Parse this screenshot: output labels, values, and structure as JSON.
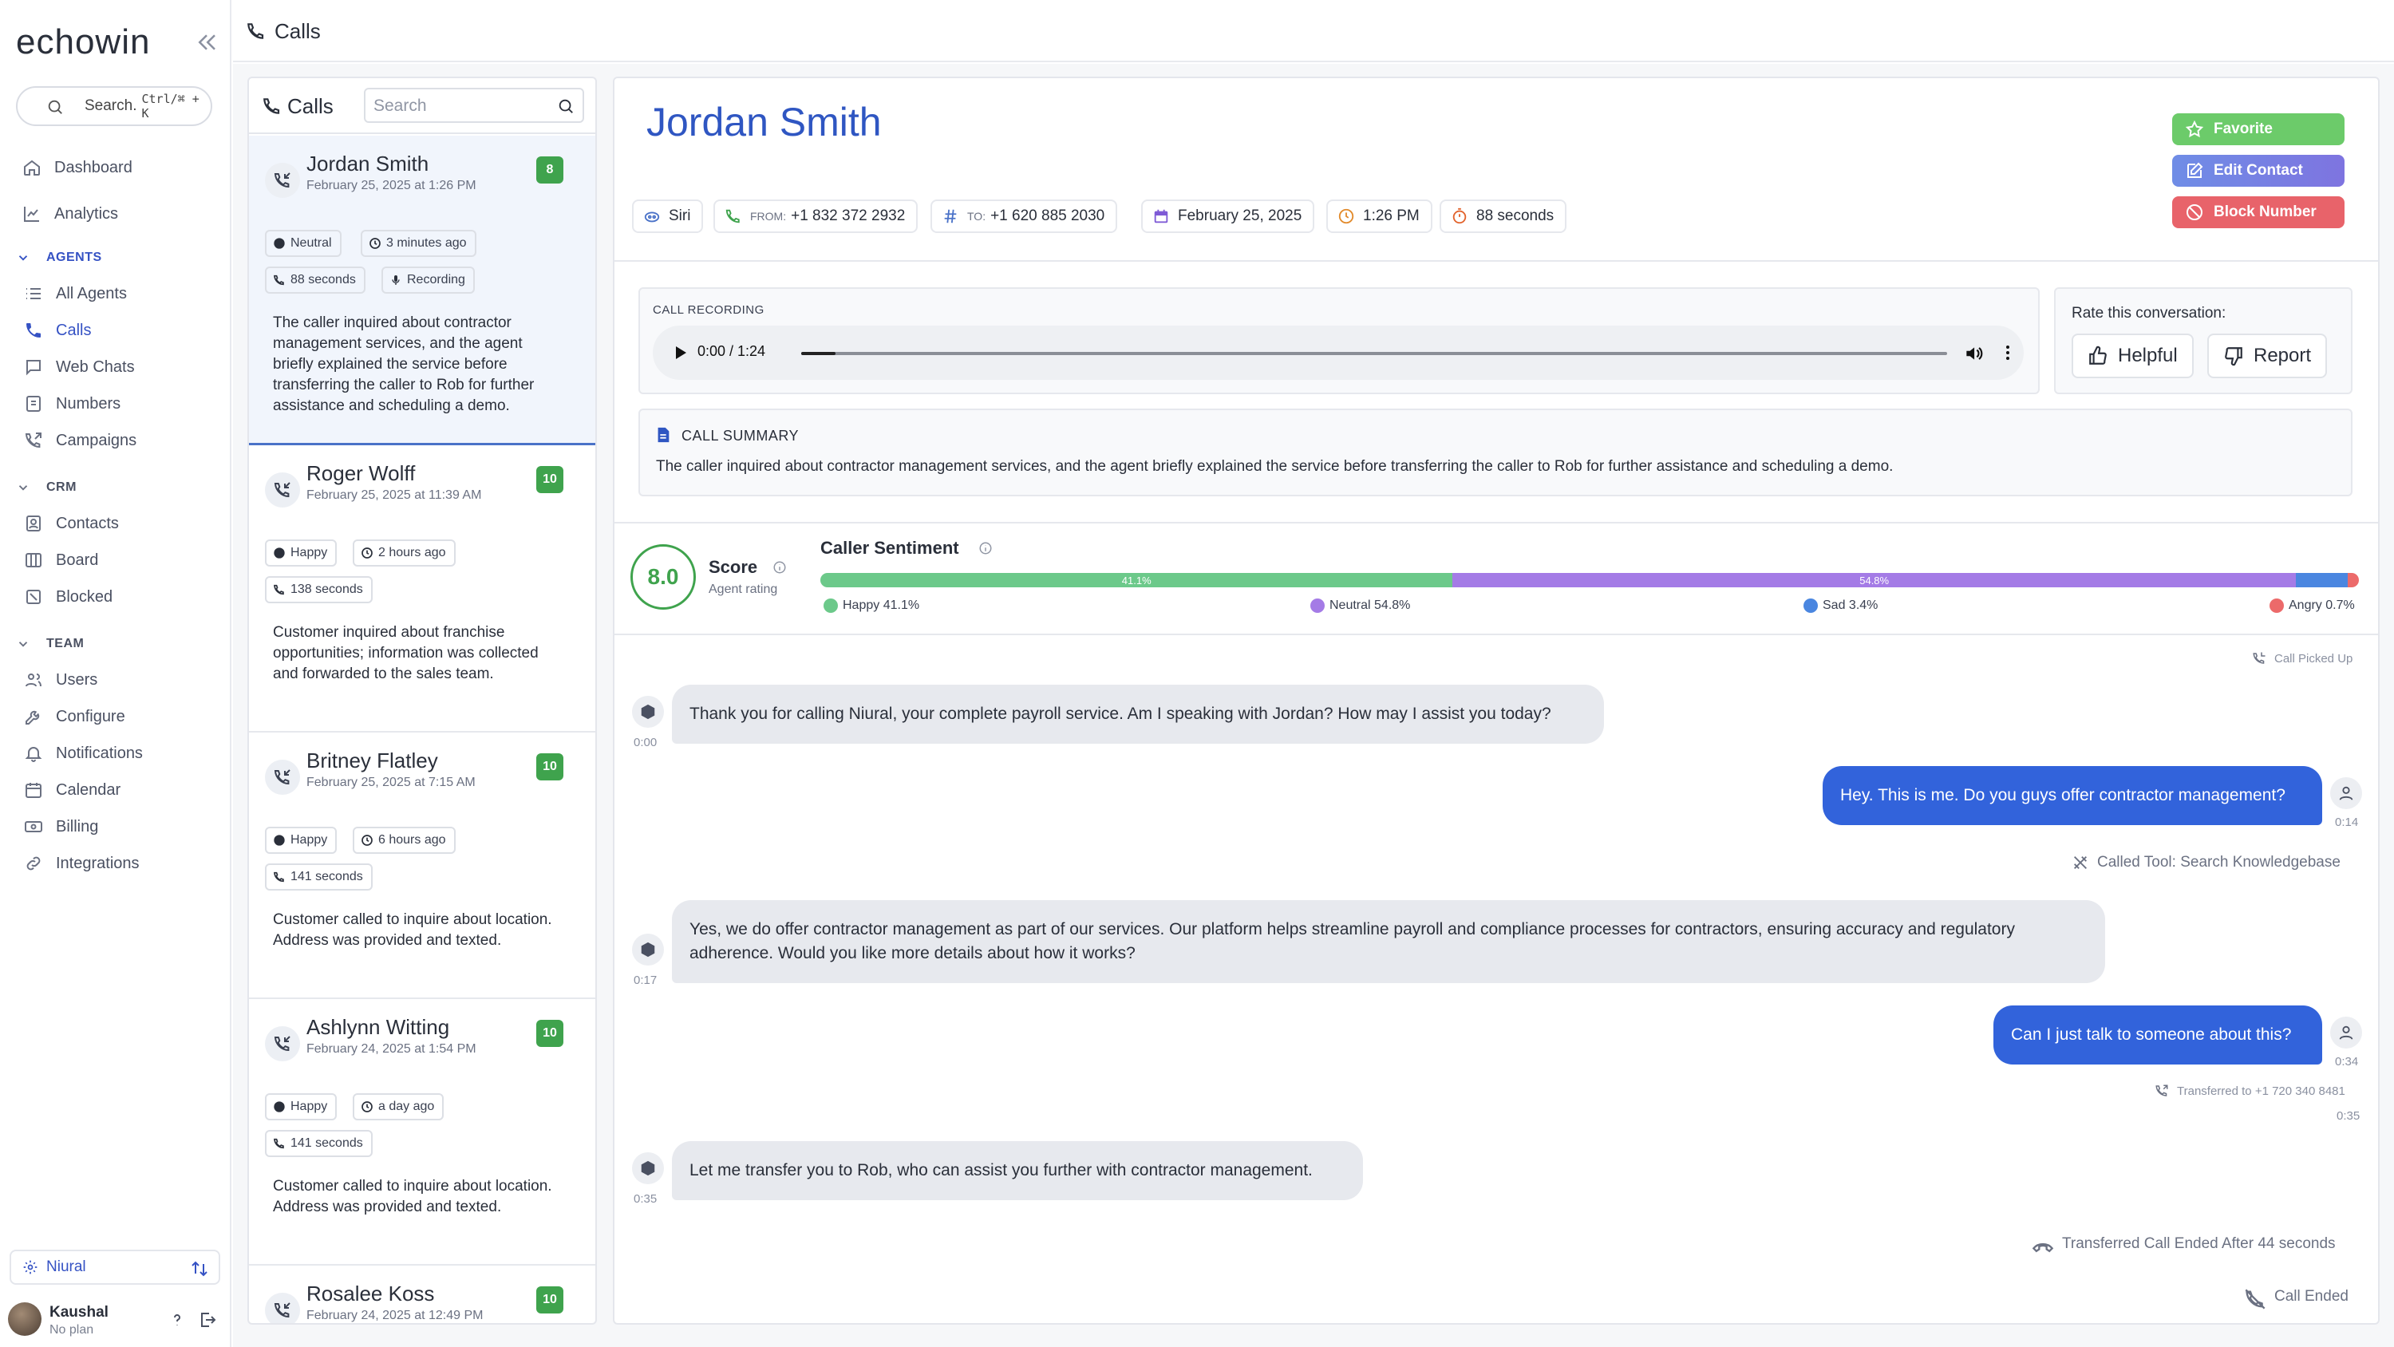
{
  "app": {
    "logo_text": "echowin",
    "collapse_icon": "double-chevron-left-icon"
  },
  "sidebar": {
    "search_label": "Search.",
    "search_shortcut": "Ctrl/⌘ + K",
    "nav": {
      "dashboard": "Dashboard",
      "analytics": "Analytics"
    },
    "sections": {
      "agents": {
        "title": "AGENTS",
        "items": [
          "All Agents",
          "Calls",
          "Web Chats",
          "Numbers",
          "Campaigns"
        ]
      },
      "crm": {
        "title": "CRM",
        "items": [
          "Contacts",
          "Board",
          "Blocked"
        ]
      },
      "team": {
        "title": "TEAM",
        "items": [
          "Users",
          "Configure",
          "Notifications",
          "Calendar",
          "Billing",
          "Integrations"
        ]
      }
    },
    "active_item": "Calls",
    "org": "Niural",
    "user": {
      "name": "Kaushal",
      "plan": "No plan"
    }
  },
  "topbar": {
    "title": "Calls"
  },
  "call_list": {
    "title": "Calls",
    "search_placeholder": "Search",
    "calls": [
      {
        "name": "Jordan Smith",
        "date": "February 25, 2025 at 1:26 PM",
        "score": "8",
        "sentiment": "Neutral",
        "ago": "3 minutes ago",
        "duration": "88 seconds",
        "recording": "Recording",
        "summary": "The caller inquired about contractor management services, and the agent briefly explained the service before transferring the caller to Rob for further assistance and scheduling a demo."
      },
      {
        "name": "Roger Wolff",
        "date": "February 25, 2025 at 11:39 AM",
        "score": "10",
        "sentiment": "Happy",
        "ago": "2 hours ago",
        "duration": "138 seconds",
        "summary": "Customer inquired about franchise opportunities; information was collected and forwarded to the sales team."
      },
      {
        "name": "Britney Flatley",
        "date": "February 25, 2025 at 7:15 AM",
        "score": "10",
        "sentiment": "Happy",
        "ago": "6 hours ago",
        "duration": "141 seconds",
        "summary": "Customer called to inquire about location. Address was provided and texted."
      },
      {
        "name": "Ashlynn Witting",
        "date": "February 24, 2025 at 1:54 PM",
        "score": "10",
        "sentiment": "Happy",
        "ago": "a day ago",
        "duration": "141 seconds",
        "summary": "Customer called to inquire about location. Address was provided and texted."
      },
      {
        "name": "Rosalee Koss",
        "date": "February 24, 2025 at 12:49 PM",
        "score": "10"
      }
    ]
  },
  "detail": {
    "name": "Jordan Smith",
    "actions": {
      "favorite": "Favorite",
      "edit": "Edit Contact",
      "block": "Block Number"
    },
    "chips": {
      "agent": "Siri",
      "from_label": "FROM:",
      "from": "+1 832 372 2932",
      "to_label": "TO:",
      "to": "+1 620 885 2030",
      "date": "February 25, 2025",
      "time": "1:26 PM",
      "duration": "88 seconds"
    },
    "recording": {
      "label": "CALL RECORDING",
      "time": "0:00 / 1:24",
      "progress_fraction": 0.03
    },
    "rating": {
      "title": "Rate this conversation:",
      "helpful": "Helpful",
      "report": "Report"
    },
    "summary": {
      "title": "CALL SUMMARY",
      "text": "The caller inquired about contractor management services, and the agent briefly explained the service before transferring the caller to Rob for further assistance and scheduling a demo."
    },
    "score": {
      "value": "8.0",
      "label": "Score",
      "sub": "Agent rating"
    },
    "sentiment": {
      "title": "Caller Sentiment",
      "segments": [
        {
          "name": "Happy",
          "percent": 41.1,
          "bar_label": "41.1%",
          "legend": "Happy 41.1%",
          "color": "#6cc98a"
        },
        {
          "name": "Neutral",
          "percent": 54.8,
          "bar_label": "54.8%",
          "legend": "Neutral 54.8%",
          "color": "#a47be6"
        },
        {
          "name": "Sad",
          "percent": 3.4,
          "bar_label": "",
          "legend": "Sad 3.4%",
          "color": "#4a86e0"
        },
        {
          "name": "Angry",
          "percent": 0.7,
          "bar_label": "",
          "legend": "Angry 0.7%",
          "color": "#ec6a6a"
        }
      ]
    },
    "transcript": {
      "picked_up": "Call Picked Up",
      "messages": [
        {
          "role": "agent",
          "text": "Thank you for calling Niural, your complete payroll service. Am I speaking with Jordan? How may I assist you today?",
          "time": "0:00"
        },
        {
          "role": "user",
          "text": "Hey. This is me. Do you guys offer contractor management?",
          "time": "0:14"
        },
        {
          "role": "agent",
          "text": "Yes, we do offer contractor management as part of our services. Our platform helps streamline payroll and compliance processes for contractors, ensuring accuracy and regulatory adherence. Would you like more details about how it works?",
          "time": "0:17"
        },
        {
          "role": "user",
          "text": "Can I just talk to someone about this?",
          "time": "0:34"
        },
        {
          "role": "agent",
          "text": "Let me transfer you to Rob, who can assist you further with contractor management.",
          "time": "0:35"
        }
      ],
      "tool_call": "Called Tool: Search Knowledgebase",
      "transferred": "Transferred to +1 720 340 8481",
      "transferred_time": "0:35",
      "transfer_ended": "Transferred Call Ended After 44 seconds",
      "call_ended": "Call Ended"
    }
  }
}
